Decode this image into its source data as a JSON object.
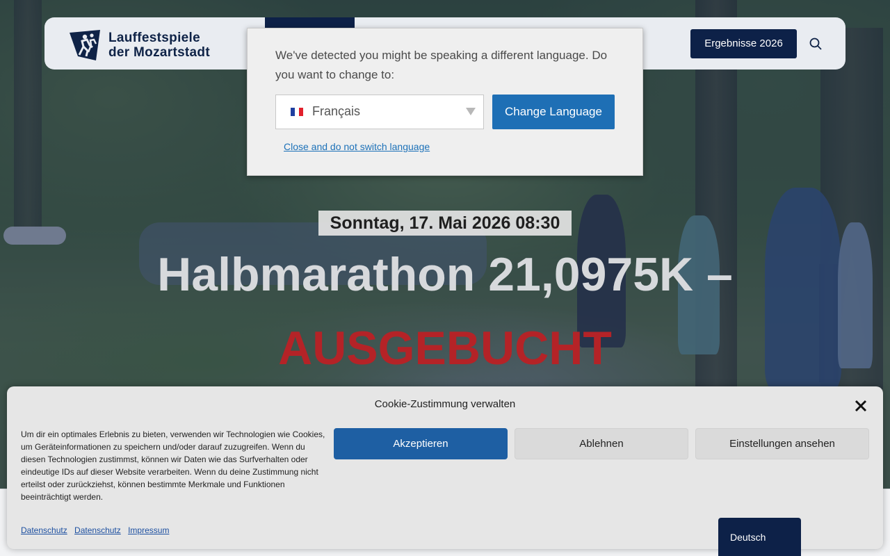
{
  "header": {
    "logo_line1": "Lauffestspiele",
    "logo_line2": "der Mozartstadt",
    "results_button": "Ergebnisse 2026"
  },
  "hero": {
    "date": "Sonntag, 17. Mai 2026 08:30",
    "title": "Halbmarathon 21,0975K –",
    "status": "AUSGEBUCHT"
  },
  "language_popup": {
    "message": "We've detected you might be speaking a different language. Do you want to change to:",
    "selected_language": "Français",
    "change_button": "Change Language",
    "close_link": "Close and do not switch language"
  },
  "cookie_banner": {
    "title": "Cookie-Zustimmung verwalten",
    "text": "Um dir ein optimales Erlebnis zu bieten, verwenden wir Technologien wie Cookies, um Geräteinformationen zu speichern und/oder darauf zuzugreifen. Wenn du diesen Technologien zustimmst, können wir Daten wie das Surfverhalten oder eindeutige IDs auf dieser Website verarbeiten. Wenn du deine Zustimmung nicht erteilst oder zurückziehst, können bestimmte Merkmale und Funktionen beeinträchtigt werden.",
    "accept_button": "Akzeptieren",
    "deny_button": "Ablehnen",
    "settings_button": "Einstellungen ansehen",
    "links": [
      "Datenschutz",
      "Datenschutz",
      "Impressum"
    ]
  },
  "language_switcher": {
    "current": "Deutsch"
  },
  "colors": {
    "brand_navy": "#0d2148",
    "accent_blue": "#1e6fb5",
    "status_red": "#b42327"
  },
  "icons": [
    "search-icon",
    "close-icon",
    "flag-fr-icon",
    "chevron-down-icon"
  ]
}
